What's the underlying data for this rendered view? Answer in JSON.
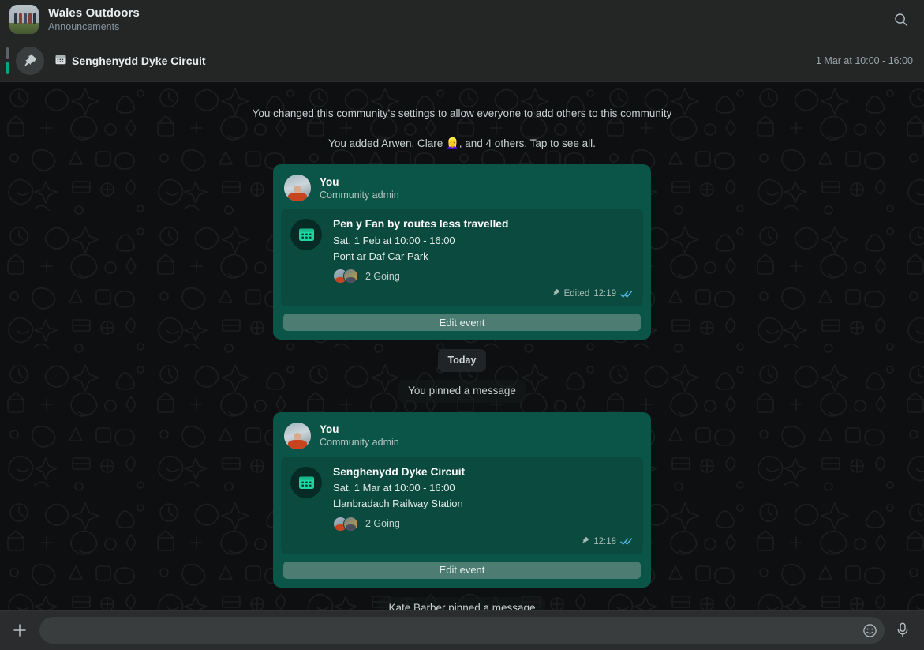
{
  "header": {
    "title": "Wales Outdoors",
    "subtitle": "Announcements",
    "logo_alt": "community-photo",
    "search_icon": "search-icon"
  },
  "pinned": {
    "pin_icon": "pin-icon",
    "calendar_icon": "calendar-icon",
    "label": "Senghenydd Dyke Circuit",
    "time_range": "1 Mar at 10:00 - 16:00"
  },
  "chat": {
    "system_messages": [
      {
        "text": "You changed this community's settings to allow everyone to add others to this community",
        "style": "plain"
      },
      {
        "text": "You added Arwen, Clare 👱‍♀️, and 4 others. Tap to see all.",
        "style": "plain"
      }
    ],
    "day_divider": "Today",
    "pinned_notice_1": "You pinned a message",
    "pinned_notice_2": "Kate Barber pinned a message",
    "events": [
      {
        "sender_name": "You",
        "sender_role": "Community admin",
        "title": "Pen y Fan by routes less travelled",
        "when": "Sat, 1 Feb at 10:00 - 16:00",
        "where": "Pont ar Daf Car Park",
        "going_count": "2 Going",
        "pin_icon": "pin-icon",
        "edited_label": "Edited",
        "time": "12:19",
        "read_status": "read-double-check",
        "action_label": "Edit event"
      },
      {
        "sender_name": "You",
        "sender_role": "Community admin",
        "title": "Senghenydd Dyke Circuit",
        "when": "Sat, 1 Mar at 10:00 - 16:00",
        "where": "Llanbradach Railway Station",
        "going_count": "2 Going",
        "pin_icon": "pin-icon",
        "edited_label": "",
        "time": "12:18",
        "read_status": "read-double-check",
        "action_label": "Edit event"
      }
    ]
  },
  "composer": {
    "attach_icon": "plus-icon",
    "input_value": "",
    "input_placeholder": "",
    "emoji_icon": "emoji-icon",
    "mic_icon": "microphone-icon"
  },
  "colors": {
    "app_background": "#0d0f10",
    "panel": "#242626",
    "bubble_green": "#0a5547",
    "bubble_inner_green": "#0b4a3f",
    "accent_teal": "#00a884",
    "read_tick_blue": "#53bdeb",
    "button_sage": "#4d7c72",
    "muted_text": "#8696a0"
  }
}
